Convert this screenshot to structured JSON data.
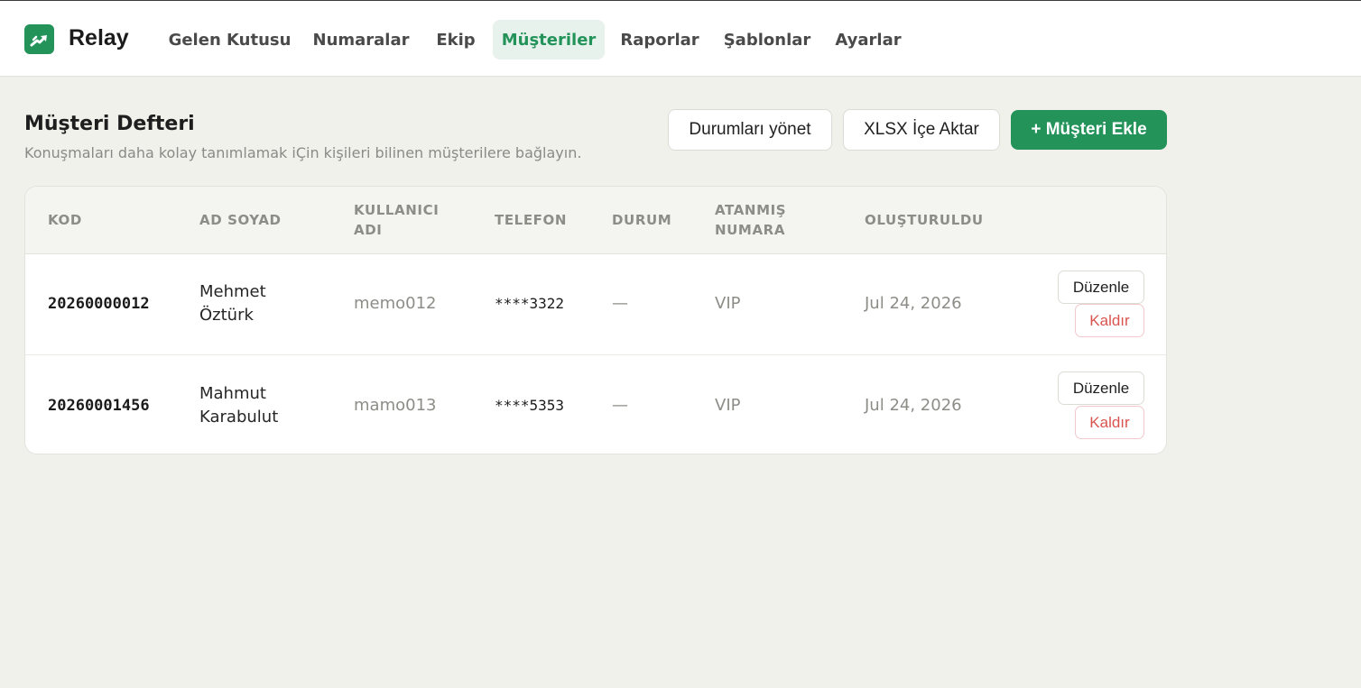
{
  "app": {
    "brand": "Relay"
  },
  "nav": {
    "tabs": [
      {
        "label": "Gelen Kutusu"
      },
      {
        "label": "Numaralar"
      },
      {
        "label": "Ekip"
      },
      {
        "label": "Müşteriler"
      },
      {
        "label": "Raporlar"
      },
      {
        "label": "Şablonlar"
      },
      {
        "label": "Ayarlar"
      }
    ],
    "active": "Müşteriler"
  },
  "page": {
    "title": "Müşteri Defteri",
    "subtitle": "Konuşmaları daha kolay tanımlamak iÇin kişileri bilinen müşterilere bağlayın."
  },
  "toolbar": {
    "manage_statuses": "Durumları yönet",
    "import_xlsx": "XLSX İçe Aktar",
    "add_customer": "+ Müşteri Ekle"
  },
  "table": {
    "columns": {
      "code": "KOD",
      "name": "AD SOYAD",
      "username_1": "KULLANICI",
      "username_2": "ADI",
      "phone": "TELEFON",
      "status": "DURUM",
      "assigned_1": "ATANMIŞ",
      "assigned_2": "NUMARA",
      "created": "OLUŞTURULDU"
    },
    "rows": [
      {
        "code": "20260000012",
        "first_name": "Mehmet",
        "last_name": "Öztürk",
        "username": "memo012",
        "phone": "****3322",
        "status": "—",
        "assigned": "VIP",
        "created": "Jul 24, 2026",
        "edit_label": "Düzenle",
        "delete_label": "Kaldır"
      },
      {
        "code": "20260001456",
        "first_name": "Mahmut",
        "last_name": "Karabulut",
        "username": "mamo013",
        "phone": "****5353",
        "status": "—",
        "assigned": "VIP",
        "created": "Jul 24, 2026",
        "edit_label": "Düzenle",
        "delete_label": "Kaldır"
      }
    ]
  },
  "colors": {
    "accent": "#23935a",
    "accent_soft": "#e6f2eb",
    "danger": "#d9534f",
    "background": "#f1f1ec"
  },
  "icons": {
    "logo": "trend-up-icon"
  }
}
